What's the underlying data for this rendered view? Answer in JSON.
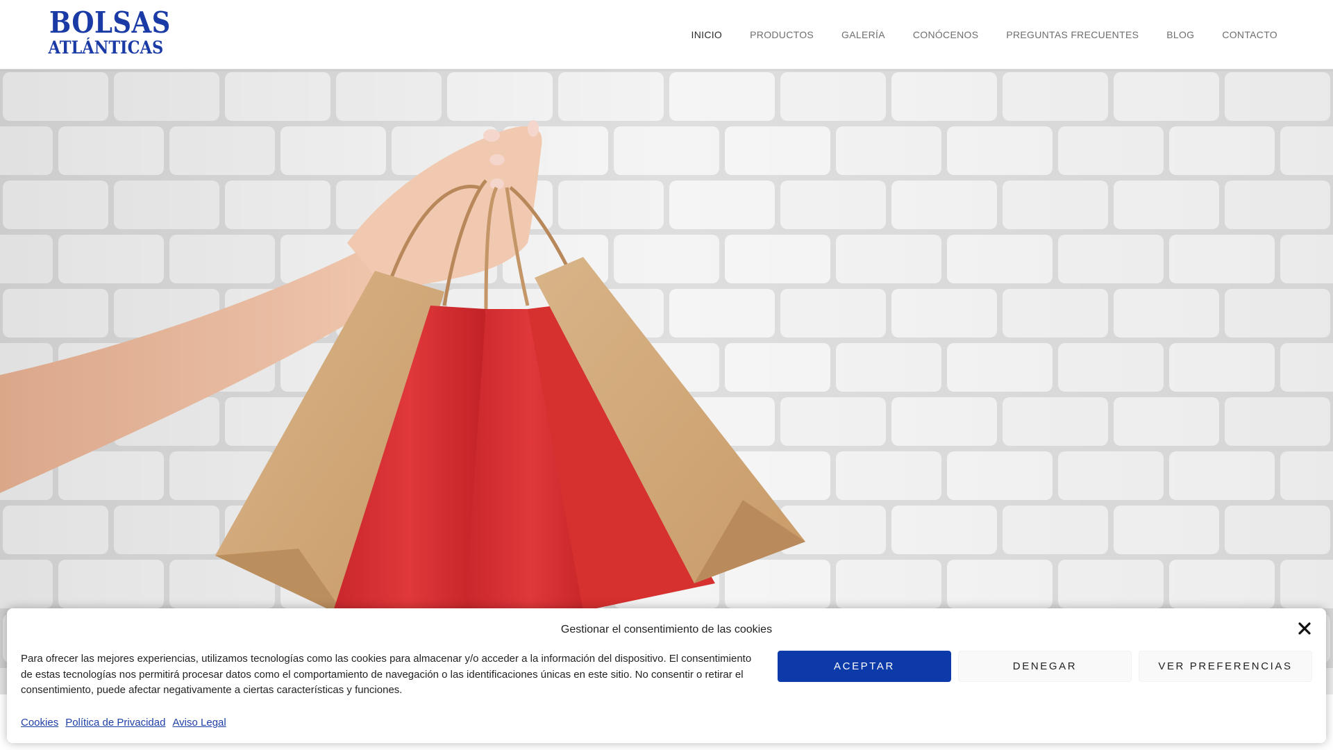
{
  "colors": {
    "brand_blue": "#1a3aa6",
    "accept_button": "#0d3aa9",
    "link_blue": "#1e3fa8",
    "nav_text": "#6e6e6e",
    "nav_active": "#2b2b2b"
  },
  "logo": {
    "line1": "BOLSAS",
    "line2": "ATLÁNTICAS"
  },
  "nav": {
    "items": [
      {
        "label": "INICIO",
        "active": true
      },
      {
        "label": "PRODUCTOS",
        "active": false
      },
      {
        "label": "GALERÍA",
        "active": false
      },
      {
        "label": "CONÓCENOS",
        "active": false
      },
      {
        "label": "PREGUNTAS FRECUENTES",
        "active": false
      },
      {
        "label": "BLOG",
        "active": false
      },
      {
        "label": "CONTACTO",
        "active": false
      }
    ]
  },
  "hero": {
    "image_icon": "hand-holding-shopping-bags-photo"
  },
  "cookie": {
    "title": "Gestionar el consentimiento de las cookies",
    "close_icon": "close-icon",
    "text": "Para ofrecer las mejores experiencias, utilizamos tecnologías como las cookies para almacenar y/o acceder a la información del dispositivo. El consentimiento de estas tecnologías nos permitirá procesar datos como el comportamiento de navegación o las identificaciones únicas en este sitio. No consentir o retirar el consentimiento, puede afectar negativamente a ciertas características y funciones.",
    "buttons": {
      "accept": "ACEPTAR",
      "deny": "DENEGAR",
      "preferences": "VER PREFERENCIAS"
    },
    "links": {
      "cookies": "Cookies",
      "privacy": "Política de Privacidad",
      "legal": "Aviso Legal"
    }
  }
}
